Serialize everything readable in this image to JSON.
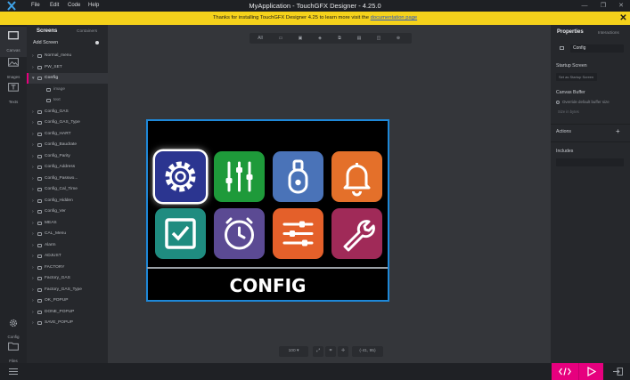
{
  "window": {
    "title": "MyApplication - TouchGFX Designer - 4.25.0",
    "menu": [
      "File",
      "Edit",
      "Code",
      "Help"
    ],
    "controls": [
      "—",
      "❐",
      "✕"
    ]
  },
  "banner": {
    "text": "Thanks for installing TouchGFX Designer 4.25 to learn more visit the",
    "link": "documentation page",
    "close": "✕",
    "color": "#f5d21b"
  },
  "leftnav": [
    {
      "label": "Canvas",
      "icon": "canvas-icon"
    },
    {
      "label": "Images",
      "icon": "images-icon"
    },
    {
      "label": "Texts",
      "icon": "texts-icon"
    },
    {
      "label": "Config",
      "icon": "config-gear-icon"
    },
    {
      "label": "Files",
      "icon": "files-icon"
    }
  ],
  "screens_panel": {
    "tab_screens": "Screens",
    "tab_containers": "Containers",
    "add_screen": "Add Screen",
    "items": [
      {
        "label": "Normal_menu",
        "type": "screen"
      },
      {
        "label": "PW_SET",
        "type": "screen"
      },
      {
        "label": "Config",
        "type": "screen",
        "selected": true,
        "expanded": true
      },
      {
        "label": "image",
        "type": "child"
      },
      {
        "label": "text",
        "type": "child"
      },
      {
        "label": "Config_GAS",
        "type": "screen"
      },
      {
        "label": "Config_GAS_Type",
        "type": "screen"
      },
      {
        "label": "Config_HART",
        "type": "screen"
      },
      {
        "label": "Config_Baudrate",
        "type": "screen"
      },
      {
        "label": "Config_Parity",
        "type": "screen"
      },
      {
        "label": "Config_Address",
        "type": "screen"
      },
      {
        "label": "Config_Passwo...",
        "type": "screen"
      },
      {
        "label": "Config_Cal_Time",
        "type": "screen"
      },
      {
        "label": "Config_Hidden",
        "type": "screen"
      },
      {
        "label": "Config_Ver",
        "type": "screen"
      },
      {
        "label": "MEAS",
        "type": "screen"
      },
      {
        "label": "CAL_Menu",
        "type": "screen"
      },
      {
        "label": "Alarm",
        "type": "screen"
      },
      {
        "label": "ADJUST",
        "type": "screen"
      },
      {
        "label": "FACTORY",
        "type": "screen"
      },
      {
        "label": "Factory_GAS",
        "type": "screen"
      },
      {
        "label": "Factory_GAS_Type",
        "type": "screen"
      },
      {
        "label": "OK_POPUP",
        "type": "screen"
      },
      {
        "label": "DONE_POPUP",
        "type": "screen"
      },
      {
        "label": "SAVE_POPUP",
        "type": "screen"
      }
    ]
  },
  "toolbar": {
    "all_label": "All"
  },
  "screen_preview": {
    "title": "CONFIG",
    "tiles": [
      {
        "icon": "gear-icon",
        "color": "#2b3590",
        "selected": true
      },
      {
        "icon": "sliders-vertical-icon",
        "color": "#1e9a3a"
      },
      {
        "icon": "sensor-probe-icon",
        "color": "#4a73b8"
      },
      {
        "icon": "bell-icon",
        "color": "#e4702a"
      },
      {
        "icon": "checkbox-icon",
        "color": "#1f8c80"
      },
      {
        "icon": "clock-icon",
        "color": "#5b4a93"
      },
      {
        "icon": "sliders-horizontal-icon",
        "color": "#e4602a"
      },
      {
        "icon": "wrench-icon",
        "color": "#a02a58"
      }
    ]
  },
  "zoombar": {
    "zoom": "100",
    "coords": "(-41, 95)"
  },
  "properties_panel": {
    "tab_properties": "Properties",
    "tab_interactions": "Interactions",
    "screen_name": "Config",
    "startup_screen_label": "Startup Screen",
    "startup_button": "Set as Startup Screen",
    "canvas_buffer_label": "Canvas Buffer",
    "override_label": "Override default buffer size",
    "buffer_field": "Size in bytes",
    "actions_label": "Actions",
    "actions_add": "+",
    "includes_label": "Includes"
  },
  "colors": {
    "accent": "#e6007e",
    "selection": "#1e88d8"
  }
}
